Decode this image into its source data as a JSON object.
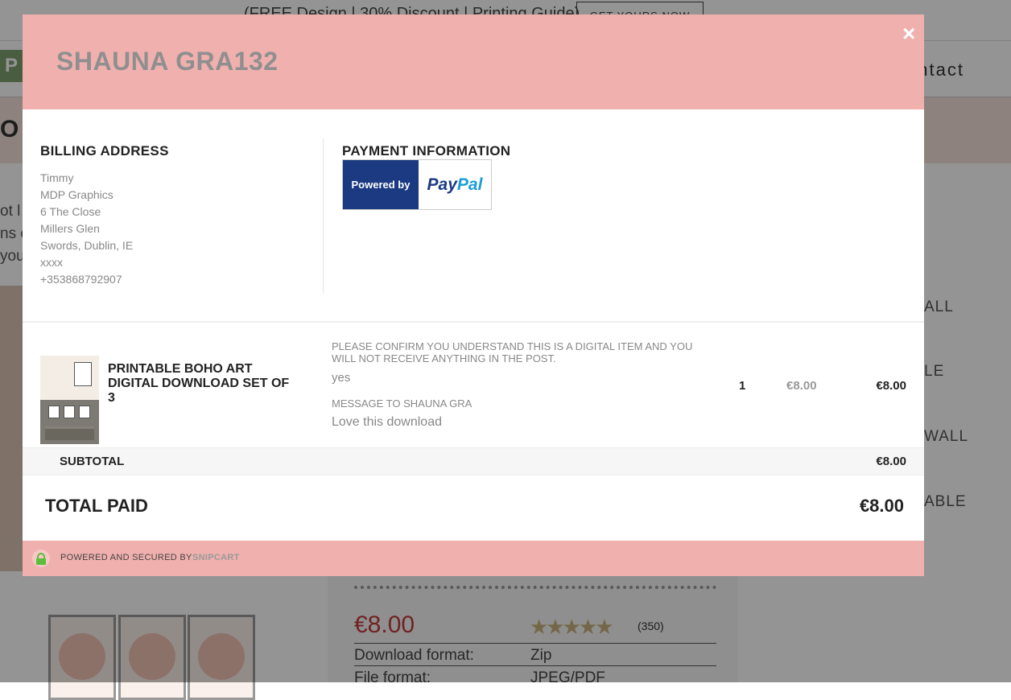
{
  "background": {
    "promo_text": "(FREE Design | 30% Discount | Printing Guide)",
    "promo_button": "GET YOURS NOW",
    "logo_text": "P",
    "nav_contact": "ontact",
    "hero_text": "O",
    "side_texts": [
      "ot l",
      "ns c",
      "you"
    ],
    "right_items": [
      "ALL",
      "LE",
      "WALL",
      "ABLE"
    ],
    "price": "€8.00",
    "stars": "★★★★★",
    "rating_count": "(350)",
    "detail_rows": [
      {
        "key": "Download format:",
        "value": "Zip"
      },
      {
        "key": "File format:",
        "value": "JPEG/PDF"
      }
    ]
  },
  "modal": {
    "title": "SHAUNA GRA132",
    "close_label": "×",
    "billing": {
      "title": "BILLING ADDRESS",
      "lines": [
        "Timmy",
        "MDP Graphics",
        "6 The Close",
        "Millers Glen",
        "Swords, Dublin, IE",
        "xxxx",
        "+353868792907"
      ]
    },
    "payment": {
      "title": "PAYMENT INFORMATION",
      "powered_by": "Powered by",
      "paypal_1": "Pay",
      "paypal_2": "Pal"
    },
    "item": {
      "name": "PRINTABLE BOHO ART DIGITAL DOWNLOAD SET OF 3",
      "question_1": "PLEASE CONFIRM YOU UNDERSTAND THIS IS A DIGITAL ITEM AND YOU WILL NOT RECEIVE ANYTHING IN THE POST.",
      "answer_1": "yes",
      "question_2": "MESSAGE TO SHAUNA GRA",
      "answer_2": "Love this download",
      "quantity": "1",
      "unit_price": "€8.00",
      "line_total": "€8.00"
    },
    "subtotal_label": "SUBTOTAL",
    "subtotal_value": "€8.00",
    "total_label": "TOTAL PAID",
    "total_value": "€8.00",
    "footer": {
      "text": "POWERED AND SECURED BY",
      "brand": "SNIPCART"
    }
  },
  "colors": {
    "modal_accent": "#f0b0ae",
    "paypal_dark": "#1c3a82",
    "paypal_light": "#1b9cd8",
    "lock_green": "#5cbf3c"
  }
}
